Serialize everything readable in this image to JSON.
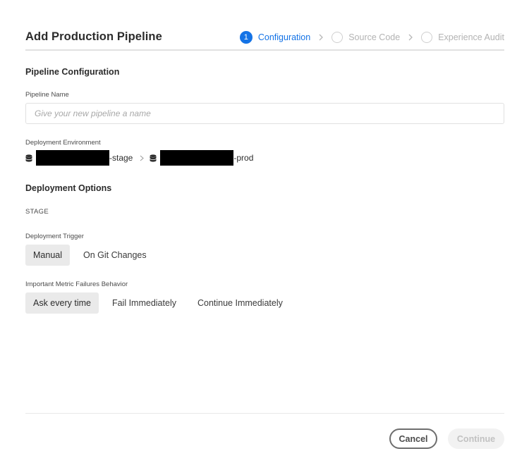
{
  "dialog": {
    "title": "Add Production Pipeline"
  },
  "wizard": {
    "steps": [
      {
        "number": "1",
        "label": "Configuration",
        "state": "active"
      },
      {
        "number": "",
        "label": "Source Code",
        "state": "pending"
      },
      {
        "number": "",
        "label": "Experience Audit",
        "state": "pending"
      }
    ]
  },
  "pipeline_config": {
    "section_title": "Pipeline Configuration",
    "name_label": "Pipeline Name",
    "name_placeholder": "Give your new pipeline a name",
    "name_value": "",
    "env_label": "Deployment Environment",
    "env_stage_suffix": "-stage",
    "env_prod_suffix": "-prod"
  },
  "deployment_options": {
    "section_title": "Deployment Options",
    "stage_label": "STAGE",
    "trigger_label": "Deployment Trigger",
    "trigger_options": [
      "Manual",
      "On Git Changes"
    ],
    "trigger_selected": "Manual",
    "failure_label": "Important Metric Failures Behavior",
    "failure_options": [
      "Ask every time",
      "Fail Immediately",
      "Continue Immediately"
    ],
    "failure_selected": "Ask every time"
  },
  "footer": {
    "cancel_label": "Cancel",
    "continue_label": "Continue",
    "continue_enabled": false
  },
  "colors": {
    "accent": "#1473e6",
    "selected_bg": "#eaeaea",
    "disabled_text": "#c2c2c2"
  },
  "icons": {
    "environment": "database-icon",
    "separator": "chevron-right-icon"
  }
}
